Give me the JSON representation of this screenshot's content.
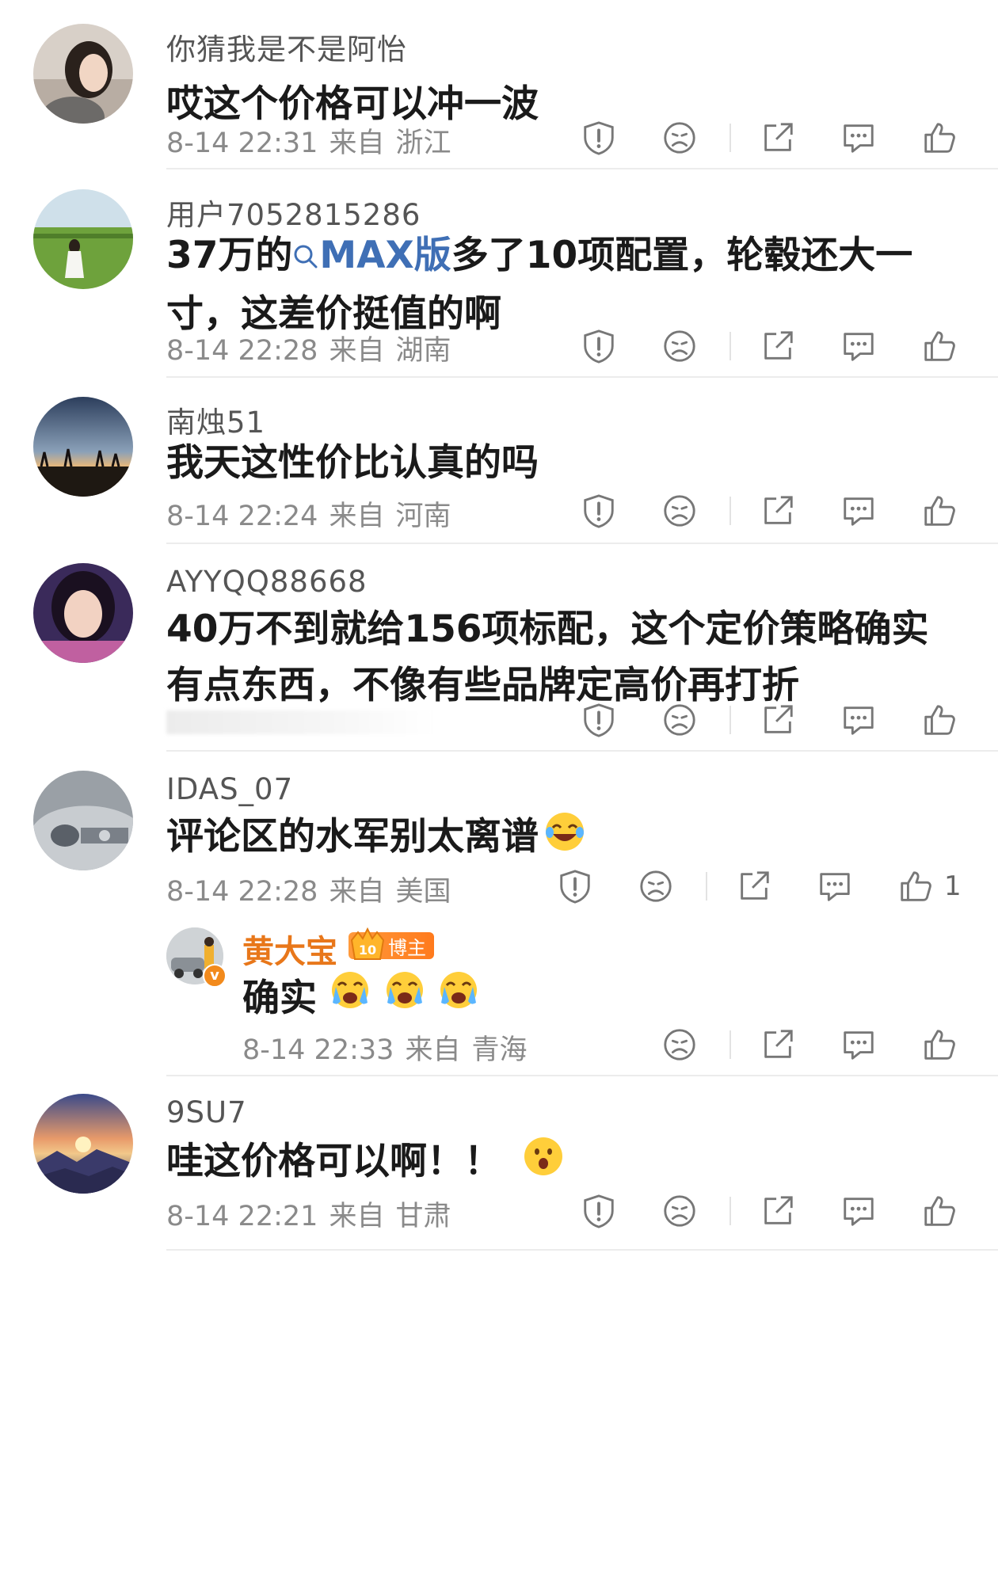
{
  "comments": [
    {
      "username": "你猜我是不是阿怡",
      "content": "哎这个价格可以冲一波",
      "time": "8-14 22:31",
      "source": "来自",
      "location": "浙江",
      "likes": ""
    },
    {
      "username": "用户7052815286",
      "content_pre": "37万的",
      "link_text": "MAX版",
      "content_post": "多了10项配置，轮毂还大一寸，这差价挺值的啊",
      "time": "8-14 22:28",
      "source": "来自",
      "location": "湖南",
      "likes": ""
    },
    {
      "username": "南烛51",
      "content": "我天这性价比认真的吗",
      "time": "8-14 22:24",
      "source": "来自",
      "location": "河南",
      "likes": ""
    },
    {
      "username": "AYYQQ88668",
      "content": "40万不到就给156项标配，这个定价策略确实有点东西，不像有些品牌定高价再打折",
      "likes": ""
    },
    {
      "username": "IDAS_07",
      "content": "评论区的水军别太离谱",
      "time": "8-14 22:28",
      "source": "来自",
      "location": "美国",
      "likes": "1",
      "reply": {
        "username": "黄大宝",
        "badge": "博主",
        "badge_num": "10",
        "content": "确实",
        "time": "8-14 22:33",
        "source": "来自",
        "location": "青海"
      }
    },
    {
      "username": "9SU7",
      "content": "哇这价格可以啊！！",
      "time": "8-14 22:21",
      "source": "来自",
      "location": "甘肃",
      "likes": ""
    }
  ],
  "icons": {
    "report": "report-icon",
    "dislike": "dislike-icon",
    "share": "share-icon",
    "comment": "comment-icon",
    "like": "like-icon"
  },
  "colors": {
    "link": "#3f6fb5",
    "blogger_name": "#e8771a",
    "badge": "#ff8a2c",
    "meta": "#8a8a8a"
  }
}
